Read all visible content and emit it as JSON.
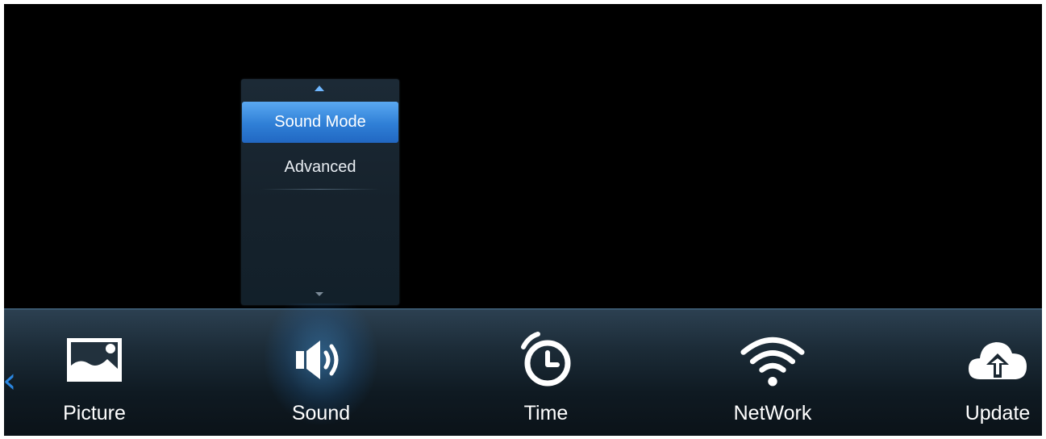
{
  "submenu": {
    "items": [
      {
        "label": "Sound Mode",
        "selected": true
      },
      {
        "label": "Advanced",
        "selected": false
      }
    ],
    "scroll_up_icon": "triangle-up-icon",
    "scroll_down_icon": "triangle-down-icon"
  },
  "nav": {
    "left_arrow_icon": "chevron-left-icon",
    "items": [
      {
        "label": "Picture",
        "icon": "picture-icon",
        "selected": false
      },
      {
        "label": "Sound",
        "icon": "speaker-icon",
        "selected": true
      },
      {
        "label": "Time",
        "icon": "clock-icon",
        "selected": false
      },
      {
        "label": "NetWork",
        "icon": "wifi-icon",
        "selected": false
      },
      {
        "label": "Update",
        "icon": "cloud-upload-icon",
        "selected": false
      }
    ]
  },
  "colors": {
    "accent": "#2f7fd6",
    "chevron": "#2a86e0",
    "bar_top": "#2c4051",
    "background": "#000000"
  }
}
